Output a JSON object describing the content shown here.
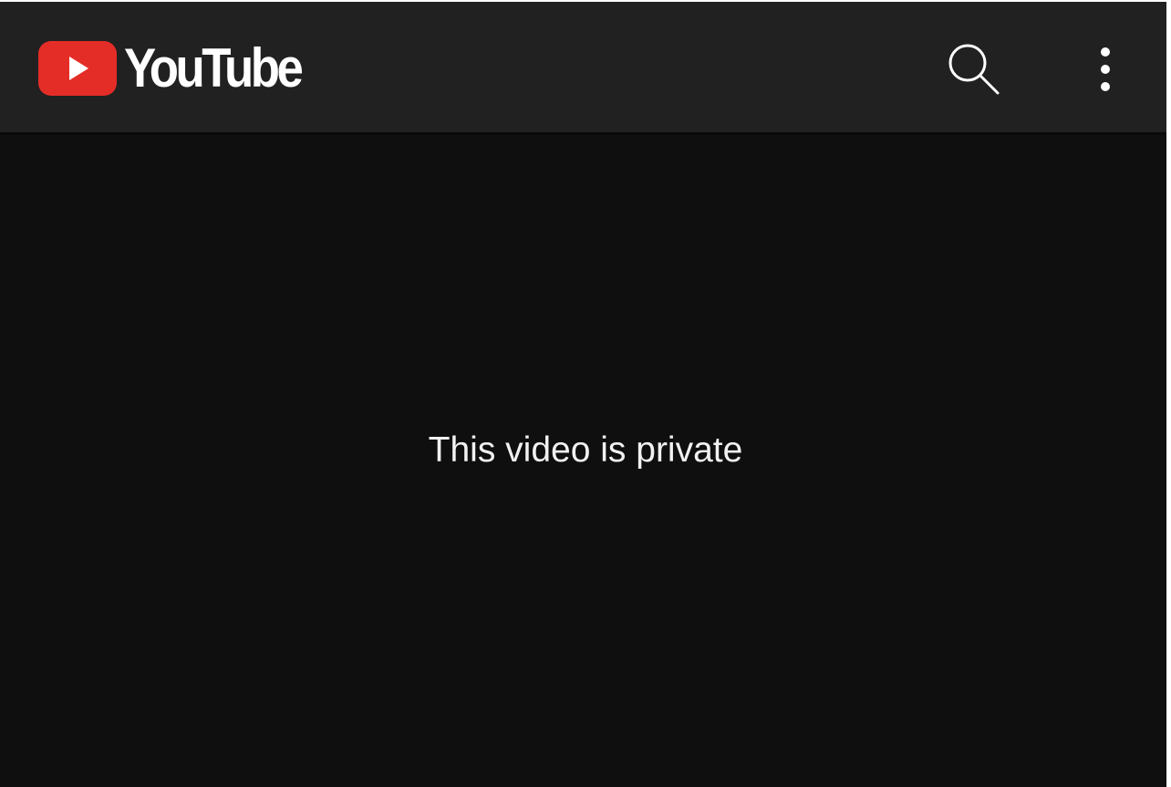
{
  "app": {
    "name": "YouTube",
    "logo_text": "YouTube",
    "brand_color": "#ff0000",
    "header_background": "#212121",
    "content_background": "#0f0f0f"
  },
  "header": {
    "search_icon": "search-icon",
    "more_icon": "more-vertical-icon"
  },
  "player": {
    "message": "This video is private"
  }
}
